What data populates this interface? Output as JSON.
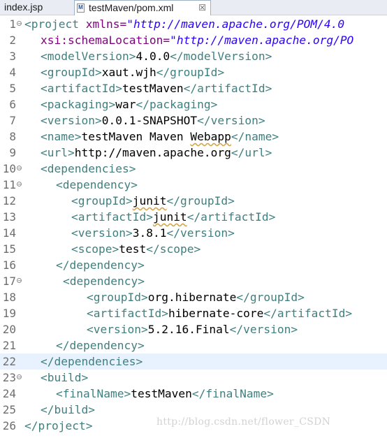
{
  "tabs": [
    {
      "label": "index.jsp",
      "active": false
    },
    {
      "label": "testMaven/pom.xml",
      "active": true,
      "close": "☒",
      "icon": "M"
    }
  ],
  "editor": {
    "current_line": 22,
    "lines": [
      {
        "n": "1",
        "fold": true
      },
      {
        "n": "2"
      },
      {
        "n": "3"
      },
      {
        "n": "4"
      },
      {
        "n": "5"
      },
      {
        "n": "6"
      },
      {
        "n": "7"
      },
      {
        "n": "8"
      },
      {
        "n": "9"
      },
      {
        "n": "10",
        "fold": true
      },
      {
        "n": "11",
        "fold": true
      },
      {
        "n": "12"
      },
      {
        "n": "13"
      },
      {
        "n": "14"
      },
      {
        "n": "15"
      },
      {
        "n": "16"
      },
      {
        "n": "17",
        "fold": true
      },
      {
        "n": "18"
      },
      {
        "n": "19"
      },
      {
        "n": "20"
      },
      {
        "n": "21"
      },
      {
        "n": "22"
      },
      {
        "n": "23",
        "fold": true
      },
      {
        "n": "24"
      },
      {
        "n": "25"
      },
      {
        "n": "26"
      }
    ]
  },
  "code": {
    "l1": {
      "tag": "<project",
      "attr": " xmlns=",
      "val": "\"http://maven.apache.org/POM/4.0"
    },
    "l2": {
      "attr": "xsi:schemaLocation=",
      "val": "\"http://maven.apache.org/PO"
    },
    "l3": {
      "open": "<modelVersion>",
      "text": "4.0.0",
      "close": "</modelVersion>"
    },
    "l4": {
      "open": "<groupId>",
      "text": "xaut.wjh",
      "close": "</groupId>"
    },
    "l5": {
      "open": "<artifactId>",
      "text": "testMaven",
      "close": "</artifactId>"
    },
    "l6": {
      "open": "<packaging>",
      "text": "war",
      "close": "</packaging>"
    },
    "l7": {
      "open": "<version>",
      "text": "0.0.1-SNAPSHOT",
      "close": "</version>"
    },
    "l8": {
      "open": "<name>",
      "text1": "testMaven Maven ",
      "text2": "Webapp",
      "close": "</name>"
    },
    "l9": {
      "open": "<url>",
      "text": "http://maven.apache.org",
      "close": "</url>"
    },
    "l10": {
      "tag": "<dependencies>"
    },
    "l11": {
      "tag": "<dependency>"
    },
    "l12": {
      "open": "<groupId>",
      "text": "junit",
      "close": "</groupId>"
    },
    "l13": {
      "open": "<artifactId>",
      "text": "junit",
      "close": "</artifactId>"
    },
    "l14": {
      "open": "<version>",
      "text": "3.8.1",
      "close": "</version>"
    },
    "l15": {
      "open": "<scope>",
      "text": "test",
      "close": "</scope>"
    },
    "l16": {
      "tag": "</dependency>"
    },
    "l17": {
      "tag": "<dependency>"
    },
    "l18": {
      "open": "<groupId>",
      "text": "org.hibernate",
      "close": "</groupId>"
    },
    "l19": {
      "open": "<artifactId>",
      "text": "hibernate-core",
      "close": "</artifactId>"
    },
    "l20": {
      "open": "<version>",
      "text": "5.2.16.Final",
      "close": "</version>"
    },
    "l21": {
      "tag": "</dependency>"
    },
    "l22": {
      "tag": "</dependencies>"
    },
    "l23": {
      "tag": "<build>"
    },
    "l24": {
      "open": "<finalName>",
      "text": "testMaven",
      "close": "</finalName>"
    },
    "l25": {
      "tag": "</build>"
    },
    "l26": {
      "tag": "</project>"
    }
  },
  "watermark": "http://blog.csdn.net/flower_CSDN",
  "colors": {
    "tag": "#3f7f7f",
    "attribute": "#7f007f",
    "value": "#2a00ff",
    "text": "#000000",
    "current_line": "#e8f2fe"
  }
}
